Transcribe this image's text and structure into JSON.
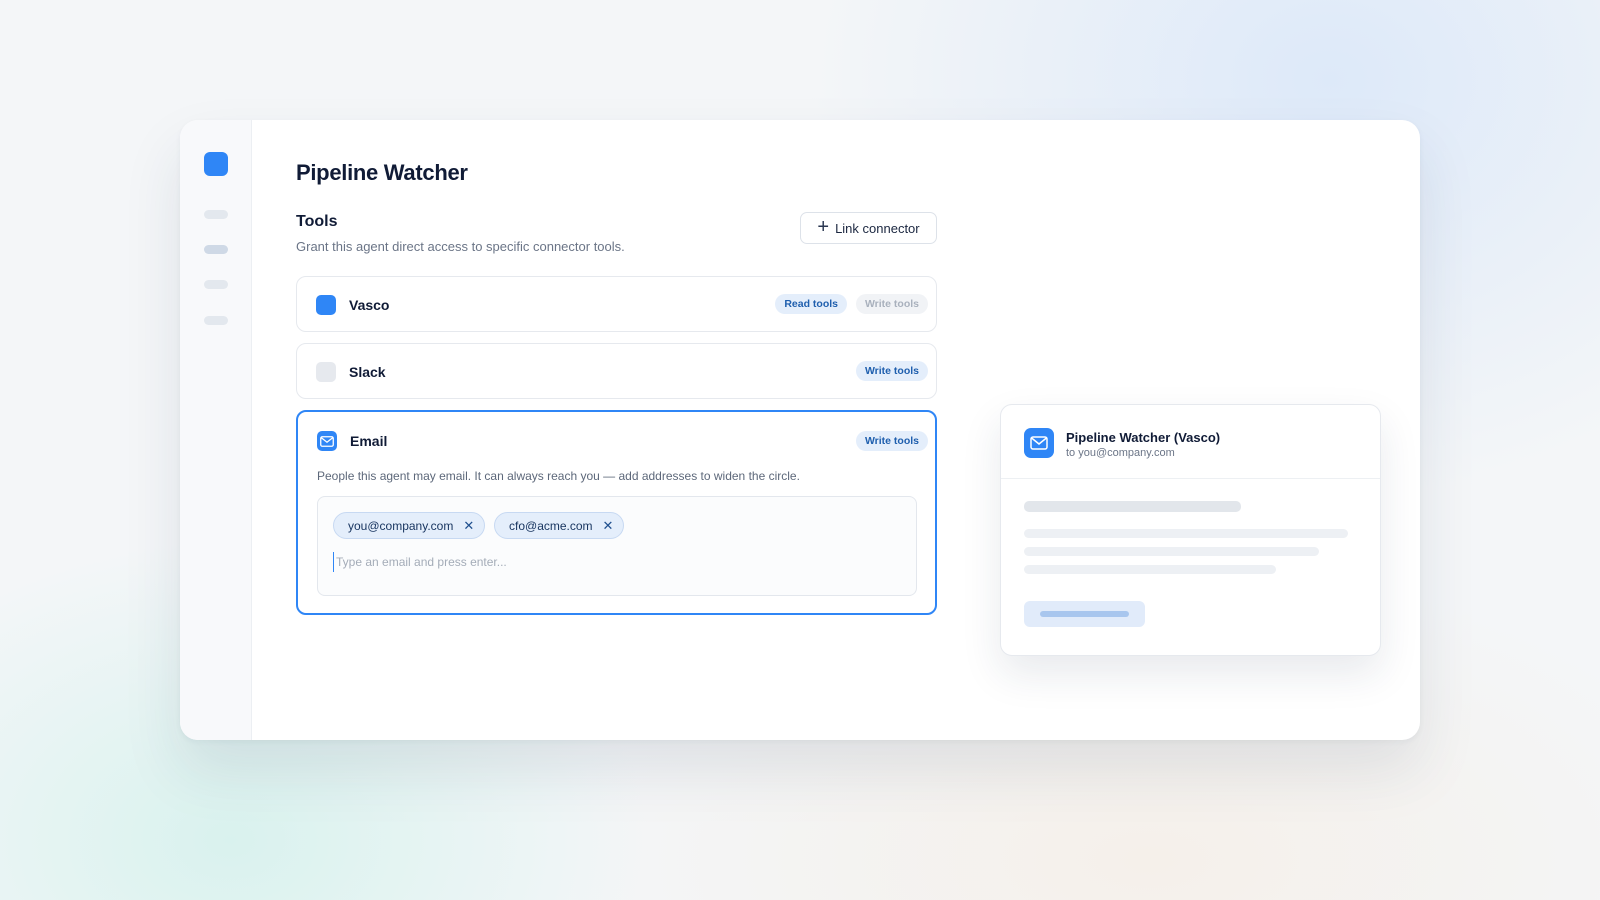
{
  "page": {
    "title": "Pipeline Watcher"
  },
  "tools": {
    "title": "Tools",
    "subtitle": "Grant this agent direct access to specific connector tools.",
    "link_connector_label": "Link connector"
  },
  "connectors": [
    {
      "name": "Vasco",
      "icon": "vasco-icon",
      "icon_color": "#2f86f6",
      "badges": [
        {
          "label": "Read tools",
          "active": true
        },
        {
          "label": "Write tools",
          "active": false
        }
      ]
    },
    {
      "name": "Slack",
      "icon": "slack-icon",
      "icon_color": "#e6e9ee",
      "badges": [
        {
          "label": "Write tools",
          "active": true
        }
      ]
    },
    {
      "name": "Email",
      "icon": "mail-icon",
      "icon_color": "#2f86f6",
      "selected": true,
      "badges": [
        {
          "label": "Write tools",
          "active": true
        }
      ],
      "description": "People this agent may email. It can always reach you — add addresses to widen the circle.",
      "recipients": [
        "you@company.com",
        "cfo@acme.com"
      ],
      "input_placeholder": "Type an email and press enter...",
      "input_value": ""
    }
  ],
  "preview": {
    "title": "Pipeline Watcher (Vasco)",
    "to": "to you@company.com",
    "icon": "mail-icon"
  },
  "colors": {
    "accent": "#2f86f6",
    "badge_active_bg": "#e4eefb",
    "badge_active_text": "#1f5fae"
  }
}
